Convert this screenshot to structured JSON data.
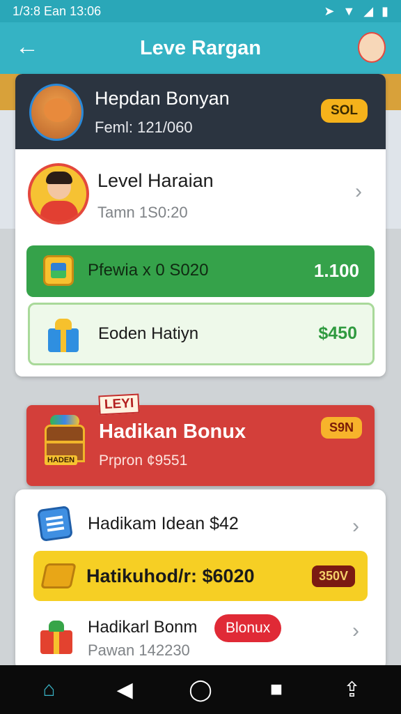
{
  "status_bar": {
    "time": "1/3:8 Ean 13:06",
    "icons": [
      "location-arrow-icon",
      "wifi-icon",
      "signal-icon",
      "battery-icon"
    ]
  },
  "app_bar": {
    "back_icon": "←",
    "title": "Leve Rargan"
  },
  "header_card": {
    "name": "Hepdan Bonyan",
    "sub": "Feml: 121/060",
    "badge": "SOL"
  },
  "profile_row": {
    "label": "Level Haraian",
    "value": "Tamn 1S0:20",
    "chevron": "›"
  },
  "green_row": {
    "label": "Pfewia x 0 S020",
    "amount": "1.100"
  },
  "lightgreen_row": {
    "label": "Eoden Hatiyn",
    "amount": "$450"
  },
  "level_tag": "LEYI",
  "red_card": {
    "chest_label": "HADEN",
    "label": "Hadikan Bonux",
    "sub": "Prpron ¢9551",
    "badge": "S9N"
  },
  "list_card": {
    "item1": {
      "label": "Hadikam Idean $42",
      "chevron": "›"
    },
    "item2": {
      "label": "Hatikuhod/r: $6020",
      "badge": "350V"
    },
    "item3": {
      "label": "Hadikarl Bonm",
      "badge": "Blonux",
      "sub": "Pawan 142230",
      "chevron": "›"
    }
  },
  "nav_bar": {
    "home": "⌂",
    "back": "◀",
    "circle": "◯",
    "square": "■",
    "share": "⇪"
  },
  "colors": {
    "accent": "#35b3c4",
    "header_dark": "#2b3440",
    "green": "#35a24a",
    "red": "#d33f3a",
    "yellow": "#f6cf24"
  }
}
